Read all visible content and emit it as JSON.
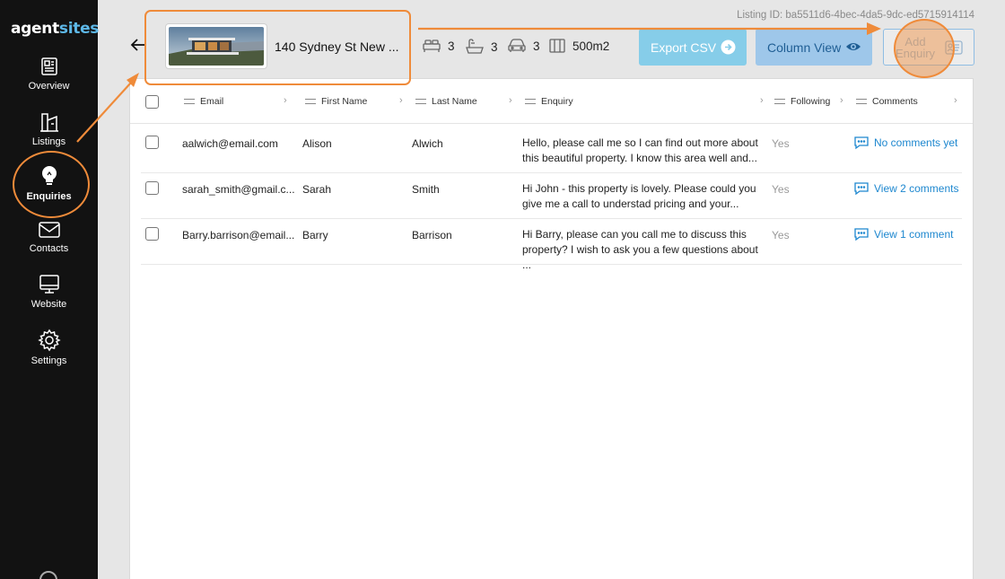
{
  "brand": {
    "part1": "agent",
    "part2": "sites"
  },
  "sidebar": {
    "items": [
      {
        "label": "Overview",
        "icon": "overview-icon"
      },
      {
        "label": "Listings",
        "icon": "listings-icon"
      },
      {
        "label": "Enquiries",
        "icon": "lightbulb-icon",
        "active": true
      },
      {
        "label": "Contacts",
        "icon": "envelope-icon"
      },
      {
        "label": "Website",
        "icon": "monitor-icon"
      },
      {
        "label": "Settings",
        "icon": "gear-icon"
      }
    ]
  },
  "header": {
    "listing_id": "Listing ID: ba5511d6-4bec-4da5-9dc-ed5715914114",
    "address": "140 Sydney St New ...",
    "features": {
      "bedrooms": "3",
      "bathrooms": "3",
      "car_spaces": "3",
      "area": "500m2"
    },
    "export_label": "Export CSV",
    "column_view_label": "Column View",
    "add_enquiry_label": "Add Enquiry"
  },
  "table": {
    "columns": [
      "Email",
      "First Name",
      "Last Name",
      "Enquiry",
      "Following",
      "Comments"
    ],
    "rows": [
      {
        "email": "aalwich@email.com",
        "first": "Alison",
        "last": "Alwich",
        "enquiry": "Hello, please call me so I can find out more about this beautiful property. I know this area well and...",
        "following": "Yes",
        "comments": "No comments yet"
      },
      {
        "email": "sarah_smith@gmail.c...",
        "first": "Sarah",
        "last": "Smith",
        "enquiry": "Hi John - this property is lovely. Please could you give me a call to understad pricing and your...",
        "following": "Yes",
        "comments": "View 2 comments"
      },
      {
        "email": "Barry.barrison@email...",
        "first": "Barry",
        "last": "Barrison",
        "enquiry": "Hi Barry, please can you call me to discuss this property? I wish to ask you a few questions about ...",
        "following": "Yes",
        "comments": "View 1 comment"
      }
    ]
  },
  "colors": {
    "sidebar": "#121212",
    "accent": "#5db8e8",
    "annotation": "#ef8b3a",
    "link": "#1d87cf"
  }
}
